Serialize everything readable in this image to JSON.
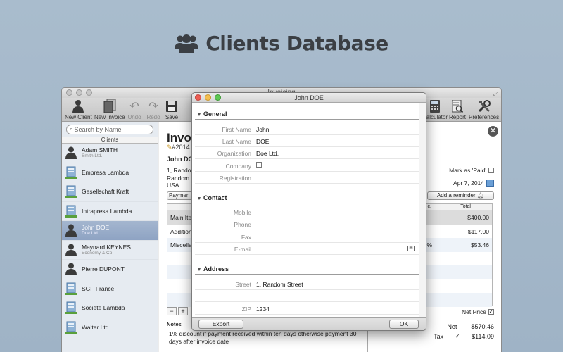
{
  "hero": {
    "title": "Clients Database"
  },
  "main_window": {
    "title": "Invoicing"
  },
  "toolbar": {
    "new_client": "New Client",
    "new_invoice": "New Invoice",
    "undo": "Undo",
    "redo": "Redo",
    "save": "Save",
    "calculator": "Calculator",
    "report": "Report",
    "preferences": "Preferences"
  },
  "sidebar": {
    "search_placeholder": "Search by Name",
    "header": "Clients",
    "clients": [
      {
        "name": "Adam SMITH",
        "sub": "Smith Ltd.",
        "type": "person"
      },
      {
        "name": "Empresa Lambda",
        "sub": "",
        "type": "company"
      },
      {
        "name": "Gesellschaft Kraft",
        "sub": "",
        "type": "company"
      },
      {
        "name": "Intrapresa Lambda",
        "sub": "",
        "type": "company"
      },
      {
        "name": "John DOE",
        "sub": "Doe Ltd.",
        "type": "person"
      },
      {
        "name": "Maynard KEYNES",
        "sub": "Economy & Co",
        "type": "person"
      },
      {
        "name": "Pierre DUPONT",
        "sub": "",
        "type": "person"
      },
      {
        "name": "SGF France",
        "sub": "",
        "type": "company"
      },
      {
        "name": "Société Lambda",
        "sub": "",
        "type": "company"
      },
      {
        "name": "Walter Ltd.",
        "sub": "",
        "type": "company"
      }
    ]
  },
  "invoice": {
    "title": "Invoi",
    "number": "#2014",
    "client": "John DO",
    "address_lines": [
      "1, Random",
      "Random",
      "USA"
    ],
    "mark_paid": "Mark as 'Paid'",
    "date": "Apr 7, 2014",
    "payment_btn": "Paymen",
    "reminder_btn": "Add a reminder",
    "col_frag": "c.",
    "col_total": "Total",
    "rows": [
      {
        "desc": "Main Ite",
        "pct": "",
        "total": "$400.00"
      },
      {
        "desc": "Addition",
        "pct": "",
        "total": "$117.00"
      },
      {
        "desc": "Miscellan",
        "pct": "%",
        "total": "$53.46"
      }
    ],
    "add_btn": "+",
    "remove_btn": "−",
    "net_price": "Net Price",
    "notes_label": "Notes",
    "notes": "1% discount if payment received within ten days otherwise payment 30 days after invoice date",
    "net_label": "Net",
    "net_value": "$570.46",
    "tax_label": "Tax",
    "tax_value": "$114.09"
  },
  "dialog": {
    "title": "John DOE",
    "sections": {
      "general": "General",
      "contact": "Contact",
      "address": "Address"
    },
    "fields": {
      "first_name_label": "First Name",
      "first_name": "John",
      "last_name_label": "Last Name",
      "last_name": "DOE",
      "organization_label": "Organization",
      "organization": "Doe Ltd.",
      "company_label": "Company",
      "registration_label": "Registration",
      "mobile_label": "Mobile",
      "phone_label": "Phone",
      "fax_label": "Fax",
      "email_label": "E-mail",
      "street_label": "Street",
      "street": "1, Random Street",
      "zip_label": "ZIP",
      "zip": "1234"
    },
    "export_btn": "Export",
    "ok_btn": "OK"
  }
}
